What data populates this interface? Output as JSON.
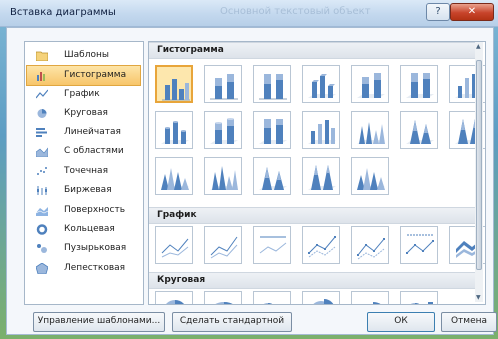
{
  "dialog": {
    "title": "Вставка диаграммы",
    "title_ghost": "Основной текстовый объект",
    "help_glyph": "?",
    "close_glyph": "✕"
  },
  "sidebar": {
    "items": [
      {
        "label": "Шаблоны",
        "icon": "folder-icon"
      },
      {
        "label": "Гистограмма",
        "icon": "column-chart-icon"
      },
      {
        "label": "График",
        "icon": "line-chart-icon"
      },
      {
        "label": "Круговая",
        "icon": "pie-chart-icon"
      },
      {
        "label": "Линейчатая",
        "icon": "bar-chart-icon"
      },
      {
        "label": "С областями",
        "icon": "area-chart-icon"
      },
      {
        "label": "Точечная",
        "icon": "scatter-chart-icon"
      },
      {
        "label": "Биржевая",
        "icon": "stock-chart-icon"
      },
      {
        "label": "Поверхность",
        "icon": "surface-chart-icon"
      },
      {
        "label": "Кольцевая",
        "icon": "doughnut-chart-icon"
      },
      {
        "label": "Пузырьковая",
        "icon": "bubble-chart-icon"
      },
      {
        "label": "Лепестковая",
        "icon": "radar-chart-icon"
      }
    ],
    "selected": "Гистограмма"
  },
  "gallery": {
    "sections": [
      {
        "title": "Гистограмма"
      },
      {
        "title": "График"
      },
      {
        "title": "Круговая"
      }
    ]
  },
  "buttons": {
    "manage_templates": "Управление шаблонами...",
    "set_default": "Сделать стандартной",
    "ok": "ОК",
    "cancel": "Отмена"
  },
  "colors": {
    "accent": "#f7c56a",
    "chart_blue": "#4f81bd",
    "chart_light": "#9bb7dc"
  }
}
